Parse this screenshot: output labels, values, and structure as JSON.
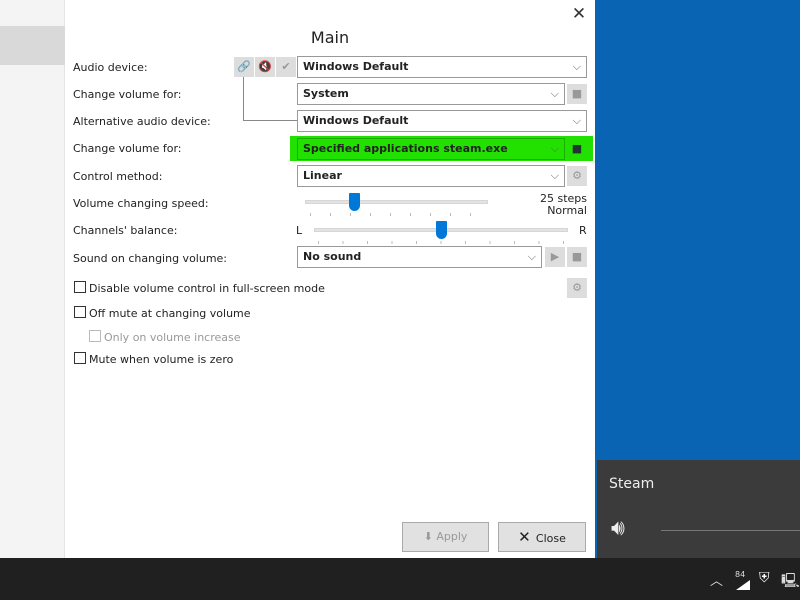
{
  "window": {
    "title": "Main",
    "close": "✕"
  },
  "labels": {
    "audio_device": "Audio device:",
    "change_volume_for": "Change volume for:",
    "alt_audio_device": "Alternative audio device:",
    "change_volume_for2": "Change volume for:",
    "control_method": "Control method:",
    "speed": "Volume changing speed:",
    "balance": "Channels' balance:",
    "sound": "Sound on changing volume:"
  },
  "values": {
    "audio_device": "Windows Default",
    "change_volume_for": "System",
    "alt_audio_device": "Windows Default",
    "change_volume_for2": "Specified applications steam.exe",
    "control_method": "Linear",
    "sound": "No sound"
  },
  "speed": {
    "steps": "25 steps",
    "mode": "Normal",
    "fraction": 0.27
  },
  "balance": {
    "left": "L",
    "right": "R",
    "fraction": 0.5
  },
  "checkboxes": [
    {
      "label": "Disable volume control in full-screen mode",
      "checked": false
    },
    {
      "label": "Off mute at changing volume",
      "checked": false
    },
    {
      "label": "Only on volume increase",
      "checked": false,
      "disabled": true
    },
    {
      "label": "Mute when volume is zero",
      "checked": false
    }
  ],
  "buttons": {
    "apply": "Apply",
    "close": "Close"
  },
  "flyout": {
    "app": "Steam"
  },
  "taskbar": {
    "battery": "84"
  },
  "colors": {
    "highlight": "#22e000",
    "accent": "#0078d7",
    "desktop": "#0a64b4"
  }
}
